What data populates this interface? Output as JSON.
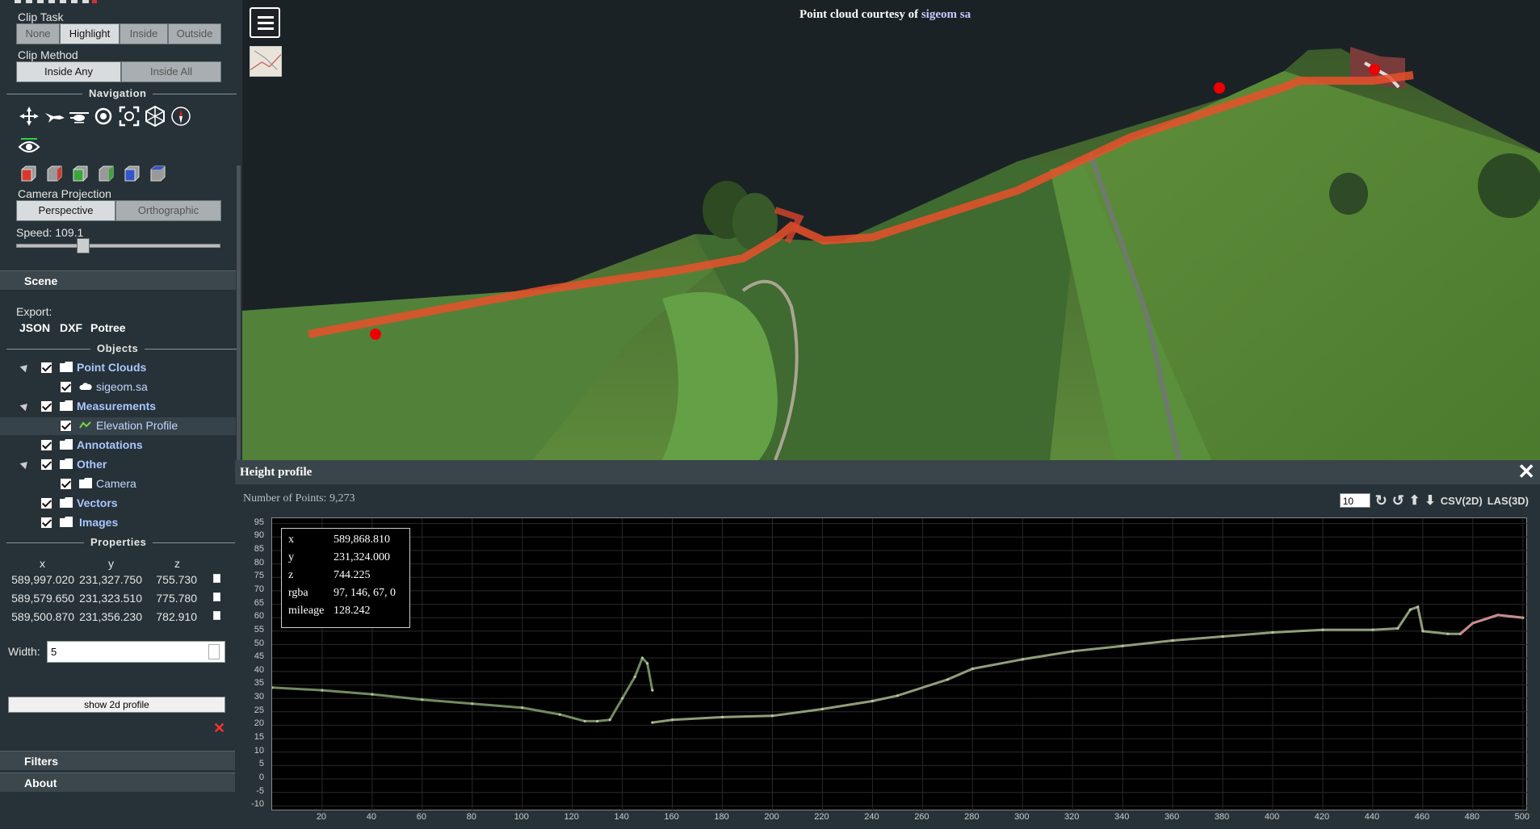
{
  "sidebar": {
    "clip_task": {
      "label": "Clip Task",
      "options": [
        "None",
        "Highlight",
        "Inside",
        "Outside"
      ],
      "selected": "Highlight"
    },
    "clip_method": {
      "label": "Clip Method",
      "options": [
        "Inside Any",
        "Inside All"
      ],
      "selected": "Inside Any"
    },
    "navigation": {
      "label": "Navigation",
      "icons": [
        "earth-controls-icon",
        "fly-controls-icon",
        "helicopter-controls-icon",
        "orbit-controls-icon",
        "focus-icon",
        "top-view-icon",
        "compass-icon",
        "eye-dome-icon"
      ],
      "view_cubes": [
        "left-view-icon",
        "front-view-icon",
        "right-view-icon",
        "back-view-icon",
        "top-view-cube-icon",
        "bottom-view-icon"
      ]
    },
    "camera_projection": {
      "label": "Camera Projection",
      "options": [
        "Perspective",
        "Orthographic"
      ],
      "selected": "Perspective"
    },
    "speed": {
      "label": "Speed: 109.1",
      "value": 109.1
    },
    "scene_label": "Scene",
    "export": {
      "label": "Export:",
      "formats": [
        "JSON",
        "DXF",
        "Potree"
      ]
    },
    "objects_label": "Objects",
    "tree": [
      {
        "label": "Point Clouds",
        "level": 0,
        "bold": true
      },
      {
        "label": "sigeom.sa",
        "level": 1,
        "bold": false
      },
      {
        "label": "Measurements",
        "level": 0,
        "bold": true
      },
      {
        "label": "Elevation Profile",
        "level": 1,
        "bold": false,
        "selected": true
      },
      {
        "label": "Annotations",
        "level": 0,
        "bold": true
      },
      {
        "label": "Other",
        "level": 0,
        "bold": true
      },
      {
        "label": "Camera",
        "level": 1,
        "bold": false
      },
      {
        "label": "Vectors",
        "level": 0,
        "bold": true
      },
      {
        "label": "Images",
        "level": 0,
        "bold": true
      }
    ],
    "properties": {
      "label": "Properties",
      "headers": [
        "x",
        "y",
        "z"
      ],
      "rows": [
        [
          "589,997.020",
          "231,327.750",
          "755.730"
        ],
        [
          "589,579.650",
          "231,323.510",
          "775.780"
        ],
        [
          "589,500.870",
          "231,356.230",
          "782.910"
        ]
      ],
      "width_label": "Width:",
      "width_value": "5",
      "show_2d_label": "show 2d profile",
      "remove_label": "✕"
    },
    "filters_label": "Filters",
    "about_label": "About"
  },
  "viewer": {
    "credit_prefix": "Point cloud courtesy of ",
    "credit_link": "sigeom sa"
  },
  "profile": {
    "title": "Height profile",
    "close": "🗙",
    "points_label": "Number of Points:",
    "points_value": "9,273",
    "tools": {
      "point_budget": "10",
      "csv": "CSV(2D)",
      "las": "LAS(3D)"
    },
    "tooltip": {
      "rows": [
        {
          "k": "x",
          "v": "589,868.810"
        },
        {
          "k": "y",
          "v": "231,324.000"
        },
        {
          "k": "z",
          "v": "744.225"
        },
        {
          "k": "rgba",
          "v": "97, 146, 67, 0"
        },
        {
          "k": "mileage",
          "v": "128.242"
        }
      ]
    }
  },
  "chart_data": {
    "type": "scatter",
    "x_ticks": [
      20,
      40,
      60,
      80,
      100,
      120,
      140,
      160,
      180,
      200,
      220,
      240,
      260,
      280,
      300,
      320,
      340,
      360,
      380,
      400,
      420,
      440,
      460,
      480,
      500
    ],
    "y_ticks": [
      -10,
      -5,
      0,
      5,
      10,
      15,
      20,
      25,
      30,
      35,
      40,
      45,
      50,
      55,
      60,
      65,
      70,
      75,
      80,
      85,
      90,
      95
    ],
    "xlim": [
      0,
      502
    ],
    "ylim": [
      -12,
      97
    ],
    "grid": true,
    "profile": [
      [
        0,
        34
      ],
      [
        20,
        33
      ],
      [
        40,
        31.5
      ],
      [
        60,
        29.5
      ],
      [
        80,
        28
      ],
      [
        100,
        26.5
      ],
      [
        115,
        24
      ],
      [
        125,
        21.5
      ],
      [
        130,
        21.5
      ],
      [
        135,
        22
      ],
      [
        140,
        30
      ],
      [
        145,
        38
      ],
      [
        148,
        45
      ],
      [
        150,
        43
      ],
      [
        152,
        33
      ],
      [
        152,
        21
      ],
      [
        160,
        22
      ],
      [
        180,
        23
      ],
      [
        200,
        23.5
      ],
      [
        220,
        26
      ],
      [
        240,
        29
      ],
      [
        250,
        31
      ],
      [
        270,
        37
      ],
      [
        280,
        41
      ],
      [
        300,
        44.5
      ],
      [
        320,
        47.5
      ],
      [
        340,
        49.5
      ],
      [
        360,
        51.5
      ],
      [
        380,
        53
      ],
      [
        400,
        54.5
      ],
      [
        420,
        55.5
      ],
      [
        440,
        55.5
      ],
      [
        450,
        56
      ],
      [
        455,
        63
      ],
      [
        458,
        64
      ],
      [
        460,
        55
      ],
      [
        470,
        54
      ],
      [
        475,
        54
      ],
      [
        480,
        58
      ],
      [
        490,
        61
      ],
      [
        500,
        60
      ]
    ]
  }
}
